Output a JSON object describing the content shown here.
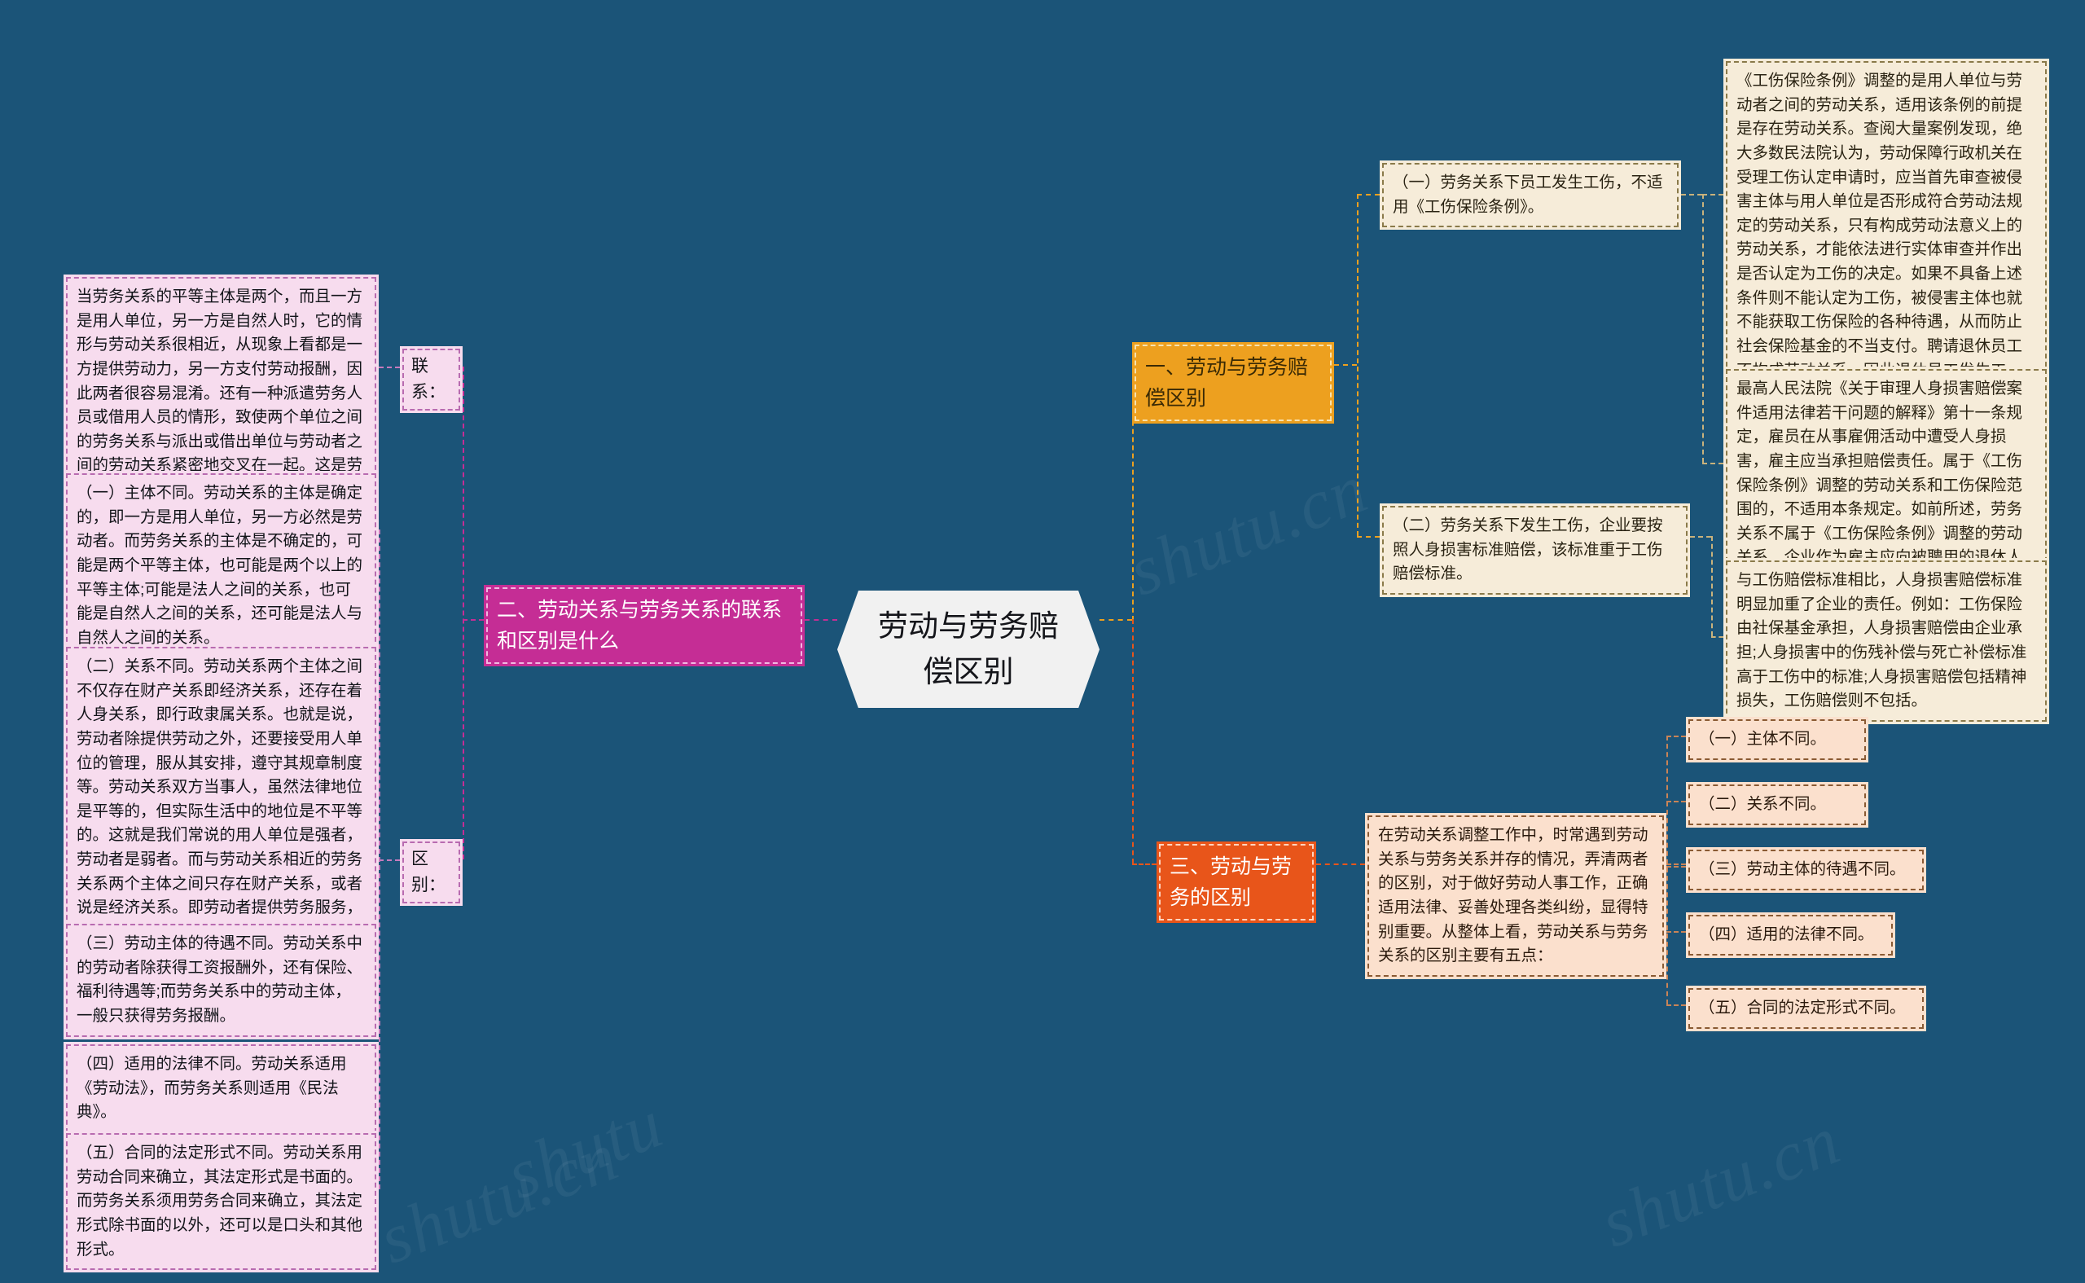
{
  "background_color": "#1b5478",
  "watermarks": [
    "shutu.cn",
    "shutu.cn",
    "shutu.cn",
    "shutu.cn",
    "shutu"
  ],
  "root": {
    "label": "劳动与劳务赔偿区别",
    "color": "#f1f1f1"
  },
  "branches": [
    {
      "id": "branch-1",
      "label": "一、劳动与劳务赔偿区别",
      "color": "#eda01f",
      "children": [
        {
          "id": "b1-c1",
          "label": "（一）劳务关系下员工发生工伤，不适用《工伤保险条例》。",
          "color": "#f6ecd9",
          "details": [
            {
              "id": "b1-c1-d1",
              "label": "《工伤保险条例》调整的是用人单位与劳动者之间的劳动关系，适用该条例的前提是存在劳动关系。查阅大量案例发现，绝大多数民法院认为，劳动保障行政机关在受理工伤认定申请时，应当首先审查被侵害主体与用人单位是否形成符合劳动法规定的劳动关系，只有构成劳动法意义上的劳动关系，才能依法进行实体审查并作出是否认定为工伤的决定。如果不具备上述条件则不能认定为工伤，被侵害主体也就不能获取工伤保险的各种待遇，从而防止社会保险基金的不当支付。聘请退休员工不构成劳动关系，因此退休员工发生工伤，不适用《工伤保险条例》。",
              "color": "#f6ecd9"
            },
            {
              "id": "b1-c1-d2",
              "label": "最高人民法院《关于审理人身损害赔偿案件适用法律若干问题的解释》第十一条规定，雇员在从事雇佣活动中遭受人身损害，雇主应当承担赔偿责任。属于《工伤保险条例》调整的劳动关系和工伤保险范围的，不适用本条规定。如前所述，劳务关系不属于《工伤保险条例》调整的劳动关系，企业作为雇主应向被聘用的退休人员承担人身损害赔偿责任。",
              "color": "#f6ecd9"
            }
          ]
        },
        {
          "id": "b1-c2",
          "label": "（二）劳务关系下发生工伤，企业要按照人身损害标准赔偿，该标准重于工伤赔偿标准。",
          "color": "#f6ecd9",
          "details": [
            {
              "id": "b1-c2-d1",
              "label": "与工伤赔偿标准相比，人身损害赔偿标准明显加重了企业的责任。例如：工伤保险由社保基金承担，人身损害赔偿由企业承担;人身损害中的伤残补偿与死亡补偿标准高于工伤中的标准;人身损害赔偿包括精神损失，工伤赔偿则不包括。",
              "color": "#f6ecd9"
            }
          ]
        }
      ]
    },
    {
      "id": "branch-2",
      "label": "二、劳动关系与劳务关系的联系和区别是什么",
      "color": "#c52d95",
      "children": [
        {
          "id": "b2-c1",
          "label": "联系：",
          "color": "#f7dcee",
          "details": [
            {
              "id": "b2-c1-d1",
              "label": "当劳务关系的平等主体是两个，而且一方是用人单位，另一方是自然人时，它的情形与劳动关系很相近，从现象上看都是一方提供劳动力，另一方支付劳动报酬，因此两者很容易混淆。还有一种派遣劳务人员或借用人员的情形，致使两个单位之间的劳务关系与派出或借出单位与劳动者之间的劳动关系紧密地交叉在一起。这是劳动关系与劳务关系相联系的一面。",
              "color": "#f7dcee"
            }
          ]
        },
        {
          "id": "b2-c2",
          "label": "区别：",
          "color": "#f7dcee",
          "details": [
            {
              "id": "b2-c2-d1",
              "label": "（一）主体不同。劳动关系的主体是确定的，即一方是用人单位，另一方必然是劳动者。而劳务关系的主体是不确定的，可能是两个平等主体，也可能是两个以上的平等主体;可能是法人之间的关系，也可能是自然人之间的关系，还可能是法人与自然人之间的关系。",
              "color": "#f7dcee"
            },
            {
              "id": "b2-c2-d2",
              "label": "（二）关系不同。劳动关系两个主体之间不仅存在财产关系即经济关系，还存在着人身关系，即行政隶属关系。也就是说，劳动者除提供劳动之外，还要接受用人单位的管理，服从其安排，遵守其规章制度等。劳动关系双方当事人，虽然法律地位是平等的，但实际生活中的地位是不平等的。这就是我们常说的用人单位是强者，劳动者是弱者。而与劳动关系相近的劳务关系两个主体之间只存在财产关系，或者说是经济关系。即劳动者提供劳务服务，用人单位支付劳务报酬。彼此之间不存在行政隶属关系。",
              "color": "#f7dcee"
            },
            {
              "id": "b2-c2-d3",
              "label": "（三）劳动主体的待遇不同。劳动关系中的劳动者除获得工资报酬外，还有保险、福利待遇等;而劳务关系中的劳动主体，一般只获得劳务报酬。",
              "color": "#f7dcee"
            },
            {
              "id": "b2-c2-d4",
              "label": "（四）适用的法律不同。劳动关系适用《劳动法》，而劳务关系则适用《民法典》。",
              "color": "#f7dcee"
            },
            {
              "id": "b2-c2-d5",
              "label": "（五）合同的法定形式不同。劳动关系用劳动合同来确立，其法定形式是书面的。而劳务关系须用劳务合同来确立，其法定形式除书面的以外，还可以是口头和其他形式。",
              "color": "#f7dcee"
            }
          ]
        }
      ]
    },
    {
      "id": "branch-3",
      "label": "三、劳动与劳务的区别",
      "color": "#e8551a",
      "children": [
        {
          "id": "b3-c1",
          "label": "在劳动关系调整工作中，时常遇到劳动关系与劳务关系并存的情况，弄清两者的区别，对于做好劳动人事工作，正确适用法律、妥善处理各类纠纷，显得特别重要。从整体上看，劳动关系与劳务关系的区别主要有五点：",
          "color": "#fbe0cd",
          "details": [
            {
              "id": "b3-c1-d1",
              "label": "（一）主体不同。",
              "color": "#fbe0cd"
            },
            {
              "id": "b3-c1-d2",
              "label": "（二）关系不同。",
              "color": "#fbe0cd"
            },
            {
              "id": "b3-c1-d3",
              "label": "（三）劳动主体的待遇不同。",
              "color": "#fbe0cd"
            },
            {
              "id": "b3-c1-d4",
              "label": "（四）适用的法律不同。",
              "color": "#fbe0cd"
            },
            {
              "id": "b3-c1-d5",
              "label": "（五）合同的法定形式不同。",
              "color": "#fbe0cd"
            }
          ]
        }
      ]
    }
  ]
}
